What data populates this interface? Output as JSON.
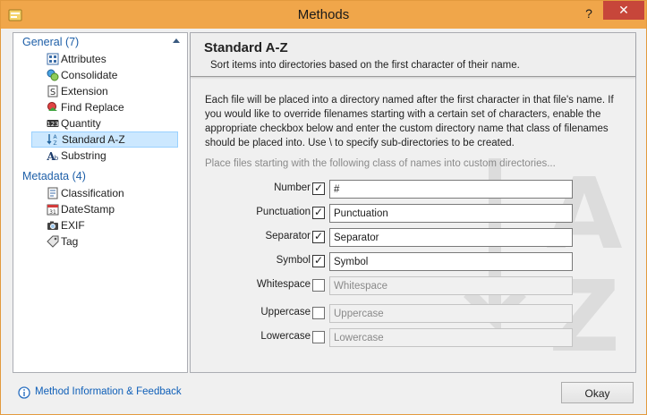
{
  "window": {
    "title": "Methods",
    "help_glyph": "?",
    "close_glyph": "✕"
  },
  "sidebar": {
    "groups": [
      {
        "label": "General (7)",
        "items": [
          {
            "label": "Attributes",
            "icon": "attributes-icon"
          },
          {
            "label": "Consolidate",
            "icon": "consolidate-icon"
          },
          {
            "label": "Extension",
            "icon": "extension-icon"
          },
          {
            "label": "Find Replace",
            "icon": "find-replace-icon"
          },
          {
            "label": "Quantity",
            "icon": "quantity-icon"
          },
          {
            "label": "Standard A-Z",
            "icon": "standard-az-icon",
            "selected": true
          },
          {
            "label": "Substring",
            "icon": "substring-icon"
          }
        ]
      },
      {
        "label": "Metadata (4)",
        "items": [
          {
            "label": "Classification",
            "icon": "classification-icon"
          },
          {
            "label": "DateStamp",
            "icon": "datestamp-icon"
          },
          {
            "label": "EXIF",
            "icon": "exif-icon"
          },
          {
            "label": "Tag",
            "icon": "tag-icon"
          }
        ]
      }
    ]
  },
  "main": {
    "title": "Standard A-Z",
    "subtitle": "Sort items into directories based on the first character of their name.",
    "description": "Each file will be placed into a directory named after the first character in that file's name. If you would like to override filenames starting with a certain set of characters, enable the appropriate checkbox below and enter the custom directory name that class of filenames should be placed into. Use \\ to specify sub-directories to be created.",
    "hint": "Place files starting with the following class of names into custom directories...",
    "rows": [
      {
        "label": "Number",
        "checked": true,
        "value": "#"
      },
      {
        "label": "Punctuation",
        "checked": true,
        "value": "Punctuation"
      },
      {
        "label": "Separator",
        "checked": true,
        "value": "Separator"
      },
      {
        "label": "Symbol",
        "checked": true,
        "value": "Symbol"
      },
      {
        "label": "Whitespace",
        "checked": false,
        "value": "Whitespace"
      },
      {
        "label": "Uppercase",
        "checked": false,
        "value": "Uppercase"
      },
      {
        "label": "Lowercase",
        "checked": false,
        "value": "Lowercase"
      }
    ],
    "tick_glyph": "✓"
  },
  "footer": {
    "link": "Method Information & Feedback",
    "okay_label": "Okay"
  },
  "colors": {
    "titlebar": "#f0a64a",
    "close": "#c7463a",
    "accent_link": "#1e5fa8",
    "selection": "#cce8ff"
  }
}
